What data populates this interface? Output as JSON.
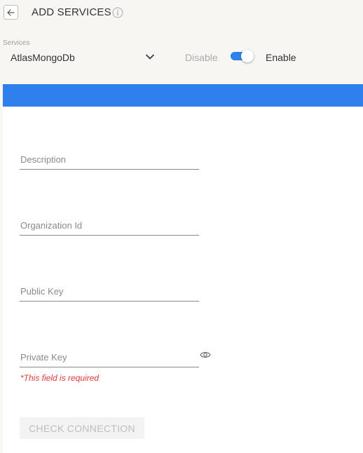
{
  "header": {
    "title": "ADD SERVICES",
    "back_icon": "arrow-left-icon",
    "info_icon": "info-icon"
  },
  "services": {
    "label": "Services",
    "selected": "AtlasMongoDb",
    "chevron_icon": "chevron-down-icon"
  },
  "toggle": {
    "disable_label": "Disable",
    "enable_label": "Enable",
    "state": "enabled",
    "accent_color": "#2f80ed"
  },
  "form": {
    "header_bar_color": "#2f80ed",
    "fields": [
      {
        "name": "description",
        "placeholder": "Description",
        "value": ""
      },
      {
        "name": "organization-id",
        "placeholder": "Organization Id",
        "value": ""
      },
      {
        "name": "public-key",
        "placeholder": "Public Key",
        "value": ""
      },
      {
        "name": "private-key",
        "placeholder": "Private Key",
        "value": ""
      }
    ],
    "private_key_toggle_icon": "eye-icon",
    "private_key_error": "*This field is required",
    "error_color": "#e53935",
    "check_connection_label": "CHECK CONNECTION"
  }
}
